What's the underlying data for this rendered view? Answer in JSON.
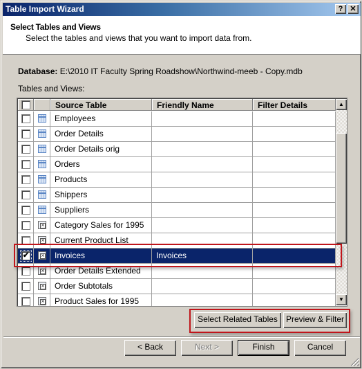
{
  "window": {
    "title": "Table Import Wizard",
    "help_label": "?",
    "close_label": "✕"
  },
  "header": {
    "title": "Select Tables and Views",
    "subtitle": "Select the tables and views that you want to import data from."
  },
  "database": {
    "label": "Database:",
    "path": "E:\\2010 IT Faculty Spring Roadshow\\Northwind-meeb - Copy.mdb"
  },
  "tables_label": "Tables and Views:",
  "grid": {
    "columns": [
      "",
      "",
      "Source Table",
      "Friendly Name",
      "Filter Details"
    ],
    "rows": [
      {
        "checked": false,
        "type": "table",
        "source": "Employees",
        "friendly": "",
        "filter": ""
      },
      {
        "checked": false,
        "type": "table",
        "source": "Order Details",
        "friendly": "",
        "filter": ""
      },
      {
        "checked": false,
        "type": "table",
        "source": "Order Details orig",
        "friendly": "",
        "filter": ""
      },
      {
        "checked": false,
        "type": "table",
        "source": "Orders",
        "friendly": "",
        "filter": ""
      },
      {
        "checked": false,
        "type": "table",
        "source": "Products",
        "friendly": "",
        "filter": ""
      },
      {
        "checked": false,
        "type": "table",
        "source": "Shippers",
        "friendly": "",
        "filter": ""
      },
      {
        "checked": false,
        "type": "table",
        "source": "Suppliers",
        "friendly": "",
        "filter": ""
      },
      {
        "checked": false,
        "type": "view",
        "source": "Category Sales for 1995",
        "friendly": "",
        "filter": ""
      },
      {
        "checked": false,
        "type": "view",
        "source": "Current Product List",
        "friendly": "",
        "filter": ""
      },
      {
        "checked": true,
        "type": "view",
        "source": "Invoices",
        "friendly": "Invoices",
        "filter": "",
        "selected": true
      },
      {
        "checked": false,
        "type": "view",
        "source": "Order Details Extended",
        "friendly": "",
        "filter": ""
      },
      {
        "checked": false,
        "type": "view",
        "source": "Order Subtotals",
        "friendly": "",
        "filter": ""
      },
      {
        "checked": false,
        "type": "view",
        "source": "Product Sales for 1995",
        "friendly": "",
        "filter": ""
      }
    ],
    "scroll_up": "▲",
    "scroll_down": "▼",
    "check_mark": "✔"
  },
  "actions": {
    "select_related": "Select Related Tables",
    "preview_filter": "Preview & Filter"
  },
  "footer": {
    "back": "< Back",
    "next": "Next >",
    "finish": "Finish",
    "cancel": "Cancel"
  },
  "colors": {
    "selection": "#0a246a",
    "highlight": "#c0151b",
    "face": "#d4d0c8"
  }
}
